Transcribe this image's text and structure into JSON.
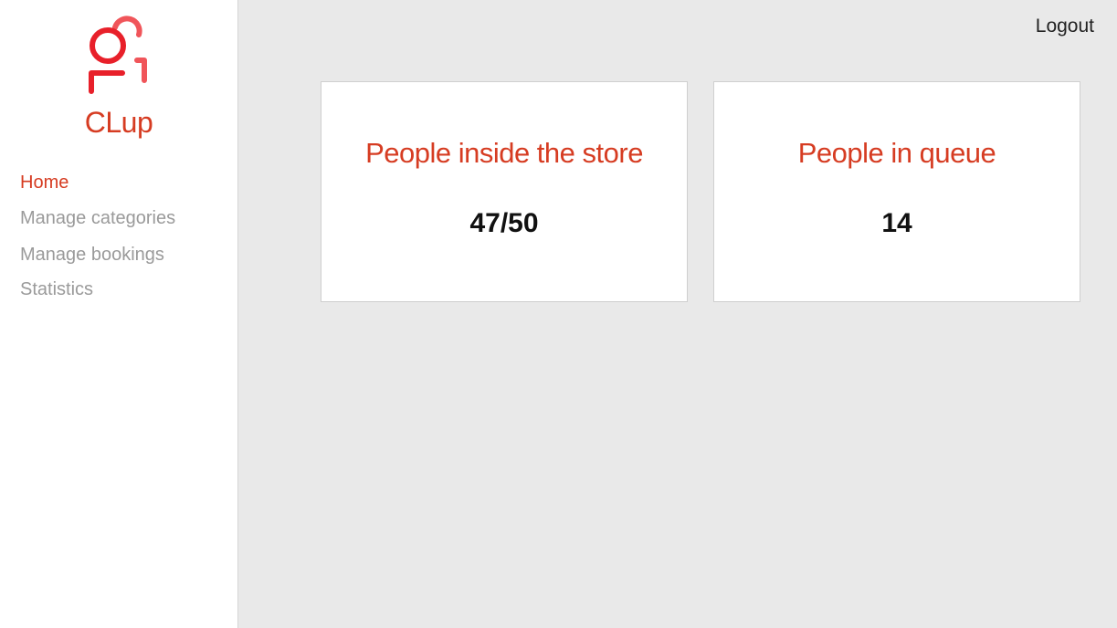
{
  "app": {
    "logo_icon": "people-logo-icon",
    "name": "CLup",
    "accent_color": "#d63c22"
  },
  "sidebar": {
    "items": [
      {
        "label": "Home",
        "active": true
      },
      {
        "label": "Manage categories",
        "active": false
      },
      {
        "label": "Manage bookings",
        "active": false
      },
      {
        "label": "Statistics",
        "active": false
      }
    ]
  },
  "header": {
    "logout_label": "Logout"
  },
  "cards": [
    {
      "title": "People inside the store",
      "value": "47/50"
    },
    {
      "title": "People in queue",
      "value": "14"
    }
  ]
}
